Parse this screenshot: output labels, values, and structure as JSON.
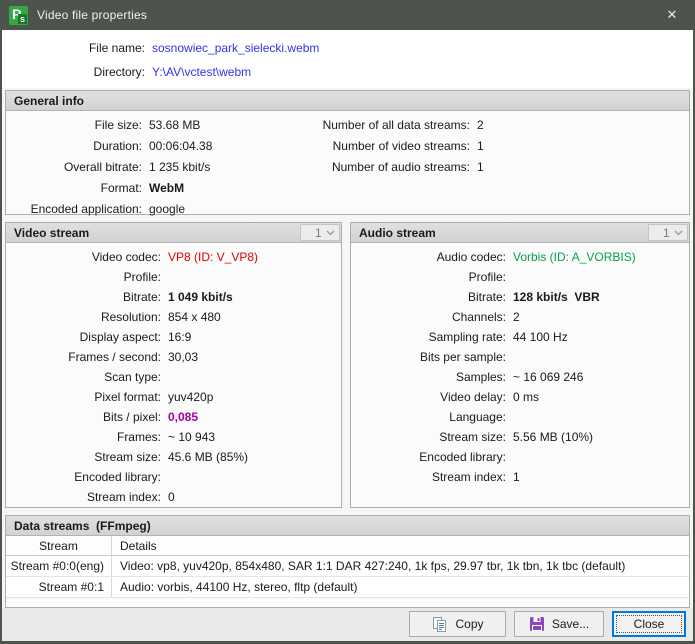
{
  "window": {
    "title": "Video file properties",
    "close_glyph": "✕",
    "app_icon_p": "P",
    "app_icon_s": "s"
  },
  "file_info": {
    "file_name_label": "File name:",
    "file_name_value": "sosnowiec_park_sielecki.webm",
    "directory_label": "Directory:",
    "directory_value": "Y:\\AV\\vctest\\webm"
  },
  "general": {
    "title": "General info",
    "left": [
      {
        "label": "File size:",
        "value": "53.68 MB"
      },
      {
        "label": "Duration:",
        "value": "00:06:04.38"
      },
      {
        "label": "Overall bitrate:",
        "value": "1 235 kbit/s"
      },
      {
        "label": "Format:",
        "value": "WebM"
      },
      {
        "label": "Encoded application:",
        "value": "google"
      }
    ],
    "right": [
      {
        "label": "Number of all data streams:",
        "value": "2"
      },
      {
        "label": "Number of video streams:",
        "value": "1"
      },
      {
        "label": "Number of audio streams:",
        "value": "1"
      }
    ]
  },
  "video": {
    "title": "Video stream",
    "selector": "1",
    "rows": [
      {
        "label": "Video codec:",
        "value": "VP8 (ID: V_VP8)"
      },
      {
        "label": "Profile:",
        "value": ""
      },
      {
        "label": "Bitrate:",
        "value": "1 049 kbit/s"
      },
      {
        "label": "Resolution:",
        "value": "854 x 480"
      },
      {
        "label": "Display aspect:",
        "value": "16:9"
      },
      {
        "label": "Frames / second:",
        "value": "30,03"
      },
      {
        "label": "Scan type:",
        "value": ""
      },
      {
        "label": "Pixel format:",
        "value": "yuv420p"
      },
      {
        "label": "Bits / pixel:",
        "value": "0,085"
      },
      {
        "label": "Frames:",
        "value": "~ 10 943"
      },
      {
        "label": "Stream size:",
        "value": "45.6 MB (85%)"
      },
      {
        "label": "Encoded library:",
        "value": ""
      },
      {
        "label": "Stream index:",
        "value": "0"
      }
    ]
  },
  "audio": {
    "title": "Audio stream",
    "selector": "1",
    "rows": [
      {
        "label": "Audio codec:",
        "value": "Vorbis (ID: A_VORBIS)"
      },
      {
        "label": "Profile:",
        "value": ""
      },
      {
        "label": "Bitrate:",
        "value": "128 kbit/s  VBR"
      },
      {
        "label": "Channels:",
        "value": "2"
      },
      {
        "label": "Sampling rate:",
        "value": "44 100 Hz"
      },
      {
        "label": "Bits per sample:",
        "value": ""
      },
      {
        "label": "Samples:",
        "value": "~ 16 069 246"
      },
      {
        "label": "Video delay:",
        "value": "0 ms"
      },
      {
        "label": "Language:",
        "value": ""
      },
      {
        "label": "Stream size:",
        "value": "5.56 MB (10%)"
      },
      {
        "label": "Encoded library:",
        "value": ""
      },
      {
        "label": "Stream index:",
        "value": "1"
      }
    ]
  },
  "data_streams": {
    "title": "Data streams  (FFmpeg)",
    "columns": [
      "Stream",
      "Details"
    ],
    "rows": [
      {
        "stream": "Stream #0:0(eng)",
        "details": "Video: vp8, yuv420p, 854x480, SAR 1:1 DAR 427:240, 1k fps, 29.97 tbr, 1k tbn, 1k tbc (default)"
      },
      {
        "stream": "Stream #0:1",
        "details": "Audio: vorbis, 44100 Hz, stereo, fltp (default)"
      }
    ]
  },
  "buttons": {
    "copy": "Copy",
    "save": "Save...",
    "close": "Close"
  },
  "colors": {
    "titlebar": "#4c544b",
    "link_blue": "#3333ee",
    "codec_red": "#e00000",
    "codec_green": "#00a14b",
    "bits_purple": "#a000a0",
    "default_button_border": "#0078d7",
    "app_icon_green": "#33a844"
  }
}
